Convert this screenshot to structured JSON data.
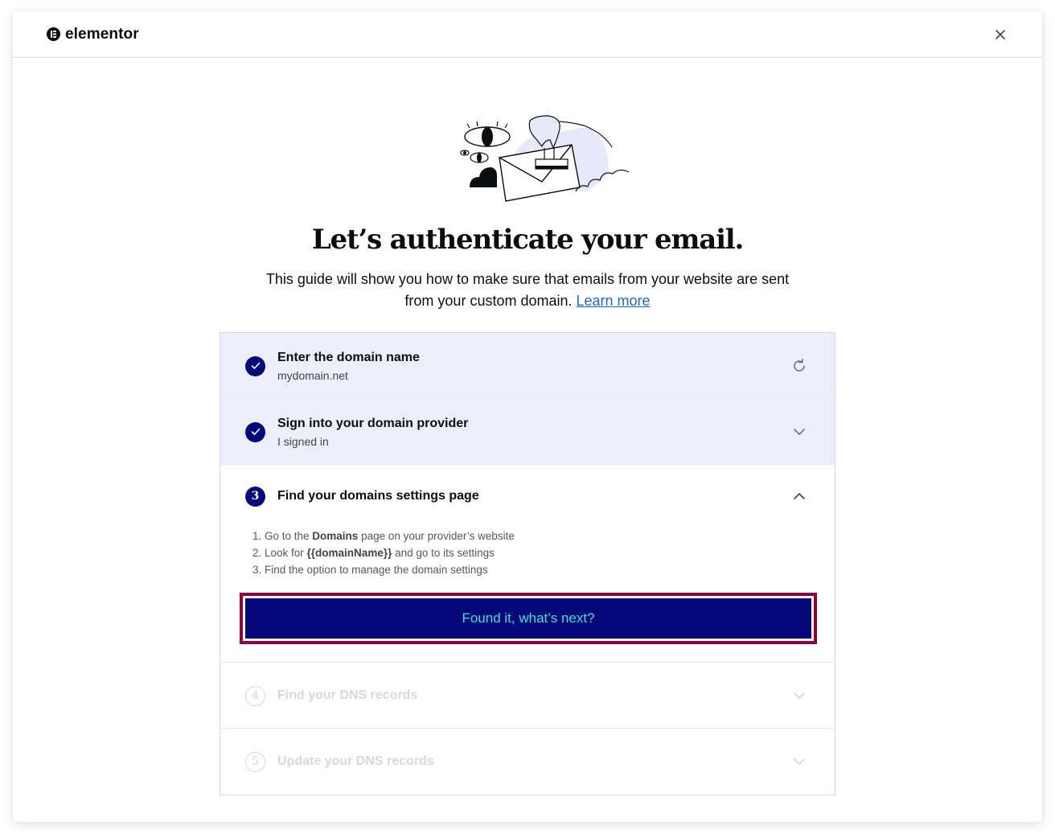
{
  "header": {
    "brand": "elementor",
    "close_icon": "close-icon"
  },
  "hero": {
    "illustration": "email-stamp-illustration",
    "title": "Let’s authenticate your email.",
    "subtitle_line1": "This guide will show you how to make sure that emails from your website are sent",
    "subtitle_line2": "from your custom domain.",
    "learn_more": "Learn more"
  },
  "steps": [
    {
      "status": "done",
      "title": "Enter the domain name",
      "subtitle": "mydomain.net",
      "action_icon": "refresh-icon"
    },
    {
      "status": "done",
      "title": "Sign into your domain provider",
      "subtitle": "I signed in",
      "action_icon": "chevron-down-icon"
    },
    {
      "status": "active",
      "number": "3",
      "title": "Find your domains settings page",
      "action_icon": "chevron-up-icon",
      "instructions": [
        {
          "prefix": "1. Go to the ",
          "bold": "Domains",
          "suffix": " page on your provider’s website"
        },
        {
          "prefix": "2. Look for ",
          "bold": "{{domainName}}",
          "suffix": " and go to its settings"
        },
        {
          "prefix": "3. Find the option to manage the domain settings",
          "bold": "",
          "suffix": ""
        }
      ],
      "button_label": "Found it, what’s next?"
    },
    {
      "status": "pending",
      "number": "4",
      "title": "Find your DNS records",
      "action_icon": "chevron-down-icon"
    },
    {
      "status": "pending",
      "number": "5",
      "title": "Update your DNS records",
      "action_icon": "chevron-down-icon"
    }
  ],
  "colors": {
    "primary": "#05087a",
    "button_text": "#3be2c8",
    "focus_ring": "#92003b",
    "done_bg": "#eeeefb",
    "link": "#2167c9"
  }
}
